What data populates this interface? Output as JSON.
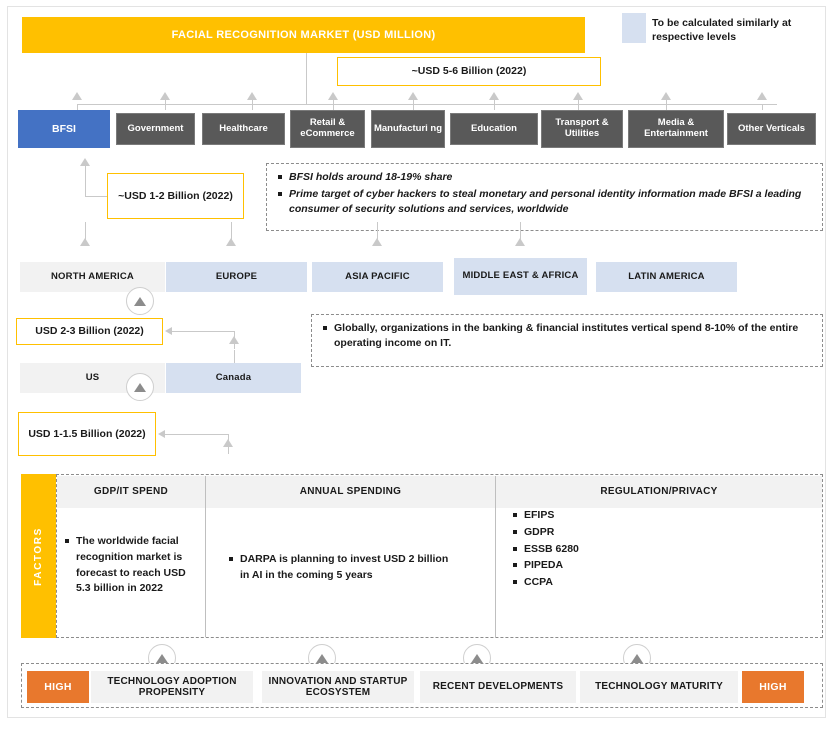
{
  "title_banner": {
    "label": "FACIAL RECOGNITION MARKET (USD MILLION)"
  },
  "legend": {
    "text": "To be calculated similarly at respective levels",
    "swatch_color": "#D6E0F0"
  },
  "values": {
    "total_market": "~USD 5-6 Billion (2022)",
    "bfsi_segment": "~USD 1-2 Billion (2022)",
    "north_america": "USD 2-3 Billion (2022)",
    "us": "USD 1-1.5 Billion (2022)"
  },
  "verticals": [
    {
      "label": "BFSI",
      "highlighted": true
    },
    {
      "label": "Government",
      "highlighted": false
    },
    {
      "label": "Healthcare",
      "highlighted": false
    },
    {
      "label": "Retail & eCommerce",
      "highlighted": false
    },
    {
      "label": "Manufacturi ng",
      "highlighted": false
    },
    {
      "label": "Education",
      "highlighted": false
    },
    {
      "label": "Transport & Utilities",
      "highlighted": false
    },
    {
      "label": "Media & Entertainment",
      "highlighted": false
    },
    {
      "label": "Other Verticals",
      "highlighted": false
    }
  ],
  "bfsi_notes": [
    "BFSI holds around 18-19% share",
    "Prime target of cyber hackers to steal monetary and personal identity information made BFSI a leading consumer of security solutions and services, worldwide"
  ],
  "regions": [
    {
      "label": "NORTH AMERICA",
      "muted": true
    },
    {
      "label": "EUROPE",
      "muted": false
    },
    {
      "label": "ASIA PACIFIC",
      "muted": false
    },
    {
      "label": "MIDDLE EAST & AFRICA",
      "muted": false
    },
    {
      "label": "LATIN AMERICA",
      "muted": false
    }
  ],
  "region_notes": [
    "Globally, organizations in the banking & financial institutes vertical spend 8-10% of the entire operating income on IT."
  ],
  "countries": [
    {
      "label": "US",
      "muted": true
    },
    {
      "label": "Canada",
      "muted": false
    }
  ],
  "factors": {
    "tab_label": "FACTORS",
    "columns": [
      {
        "header": "GDP/IT SPEND",
        "items": [
          "The worldwide facial recognition market is forecast to reach USD 5.3 billion in 2022"
        ]
      },
      {
        "header": "ANNUAL SPENDING",
        "items": [
          "DARPA is planning to invest USD 2 billion in AI in the coming 5 years"
        ]
      },
      {
        "header": "REGULATION/PRIVACY",
        "items": [
          "EFIPS",
          "GDPR",
          "ESSB 6280",
          "PIPEDA",
          "CCPA"
        ]
      }
    ]
  },
  "bottom_strip": {
    "left_rating": "HIGH",
    "right_rating": "HIGH",
    "drivers": [
      "TECHNOLOGY ADOPTION PROPENSITY",
      "INNOVATION AND STARTUP ECOSYSTEM",
      "RECENT DEVELOPMENTS",
      "TECHNOLOGY MATURITY"
    ]
  },
  "colors": {
    "banner": "#FFC000",
    "highlight_blue": "#4472C4",
    "vertical_gray": "#595959",
    "region_blue": "#D6E0F0",
    "muted_gray": "#F2F2F2",
    "rating_orange": "#E8782D",
    "callout_border": "#FFC000"
  }
}
